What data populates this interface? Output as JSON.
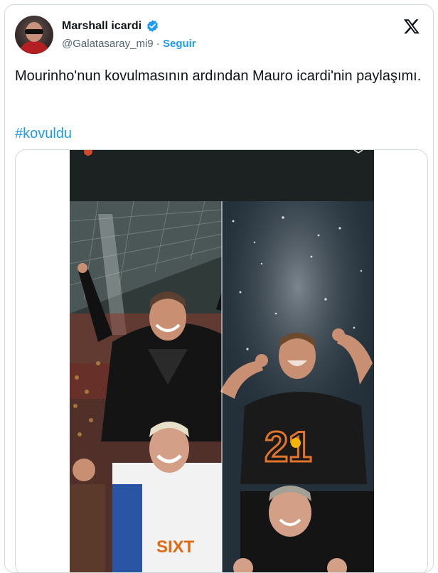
{
  "author": {
    "display_name": "Marshall icardi",
    "handle": "@Galatasaray_mi9",
    "separator": "·",
    "follow_label": "Seguir",
    "verified": true
  },
  "tweet": {
    "text": "Mourinho'nun kovulmasının ardından Mauro icardi'nin paylaşımı.",
    "hashtag": "#kovuldu"
  },
  "media": {
    "jersey_text": "SIXT",
    "jersey_number": "21"
  },
  "icons": {
    "platform_logo": "x-logo-icon",
    "verified_badge": "verified-badge-icon"
  },
  "colors": {
    "link": "#1d9bf0",
    "text_primary": "#0f1419",
    "text_secondary": "#536471",
    "border": "#cfd9de",
    "club_red": "#b41f24",
    "club_yellow": "#f5b400"
  }
}
